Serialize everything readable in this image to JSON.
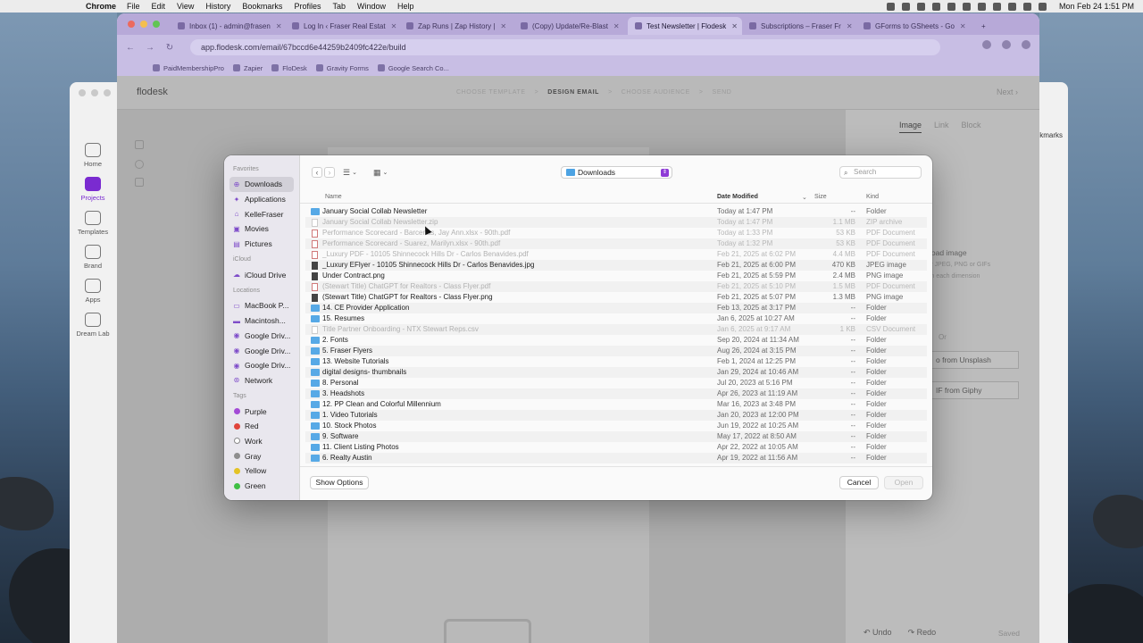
{
  "menubar": {
    "app": "Chrome",
    "items": [
      "File",
      "Edit",
      "View",
      "History",
      "Bookmarks",
      "Profiles",
      "Tab",
      "Window",
      "Help"
    ],
    "clock": "Mon Feb 24  1:51 PM"
  },
  "tabs": [
    {
      "label": "Inbox (1) - admin@frasen",
      "color": "#d9534f"
    },
    {
      "label": "Log In ‹ Fraser Real Estat",
      "color": "#5a5a5a"
    },
    {
      "label": "Zap Runs | Zap History |",
      "color": "#ff4f00"
    },
    {
      "label": "(Copy) Update/Re-Blast",
      "color": "#ff4f00"
    },
    {
      "label": "Test Newsletter | Flodesk",
      "color": "#333333"
    },
    {
      "label": "Subscriptions – Fraser Fr",
      "color": "#635bff"
    },
    {
      "label": "GForms to GSheets - Go",
      "color": "#1fa463"
    }
  ],
  "address": "app.flodesk.com/email/67bccd6e44259b2409fc422e/build",
  "bookmarks": [
    "PaidMembershipPro",
    "Zapier",
    "FloDesk",
    "Gravity Forms",
    "Google Search Co..."
  ],
  "flodesk": {
    "logo": "flodesk",
    "steps": [
      "CHOOSE TEMPLATE",
      ">",
      "DESIGN EMAIL",
      ">",
      "CHOOSE AUDIENCE",
      ">",
      "SEND"
    ],
    "next": "Next",
    "panel_tabs": [
      "Image",
      "Link",
      "Block"
    ],
    "upload_title": "load image",
    "upload_hint1": "y JPEG, PNG or GIFs",
    "upload_hint2": "in each dimension",
    "or": "Or",
    "unsplash": "o from Unsplash",
    "giphy": "IF from Giphy",
    "undo": "Undo",
    "redo": "Redo",
    "saved": "Saved"
  },
  "back_window": {
    "sidebar": [
      "Home",
      "Projects",
      "Templates",
      "Brand",
      "Apps",
      "Dream Lab"
    ],
    "bookmarks_label": "ckmarks"
  },
  "dialog": {
    "location": "Downloads",
    "search_placeholder": "Search",
    "sections": {
      "favorites": "Favorites",
      "icloud": "iCloud",
      "locations": "Locations",
      "tags": "Tags"
    },
    "favorites": [
      "Downloads",
      "Applications",
      "KelleFraser",
      "Movies",
      "Pictures"
    ],
    "icloud": [
      "iCloud Drive"
    ],
    "locations": [
      "MacBook P...",
      "Macintosh...",
      "Google Driv...",
      "Google Driv...",
      "Google Driv...",
      "Network"
    ],
    "tags": [
      {
        "name": "Purple",
        "color": "#a34bd6"
      },
      {
        "name": "Red",
        "color": "#e0443b"
      },
      {
        "name": "Work",
        "color": "#ffffff"
      },
      {
        "name": "Gray",
        "color": "#8e8e8e"
      },
      {
        "name": "Yellow",
        "color": "#e4c325"
      },
      {
        "name": "Green",
        "color": "#3fbf44"
      }
    ],
    "columns": {
      "name": "Name",
      "date": "Date Modified",
      "size": "Size",
      "kind": "Kind"
    },
    "files": [
      {
        "name": "January Social Collab Newsletter",
        "date": "Today at 1:47 PM",
        "size": "--",
        "kind": "Folder",
        "icon": "folder",
        "dim": false
      },
      {
        "name": "January Social Collab Newsletter.zip",
        "date": "Today at 1:47 PM",
        "size": "1.1 MB",
        "kind": "ZIP archive",
        "icon": "zip",
        "dim": true
      },
      {
        "name": "Performance Scorecard - Barcenas, Jay Ann.xlsx - 90th.pdf",
        "date": "Today at 1:33 PM",
        "size": "53 KB",
        "kind": "PDF Document",
        "icon": "doc",
        "dim": true
      },
      {
        "name": "Performance Scorecard - Suarez, Marilyn.xlsx - 90th.pdf",
        "date": "Today at 1:32 PM",
        "size": "53 KB",
        "kind": "PDF Document",
        "icon": "doc",
        "dim": true
      },
      {
        "name": "_Luxury PDF  - 10105 Shinnecock Hills Dr - Carlos Benavides.pdf",
        "date": "Feb 21, 2025 at 6:02 PM",
        "size": "4.4 MB",
        "kind": "PDF Document",
        "icon": "doc",
        "dim": true
      },
      {
        "name": "_Luxury EFlyer  - 10105 Shinnecock Hills Dr - Carlos Benavides.jpg",
        "date": "Feb 21, 2025 at 6:00 PM",
        "size": "470 KB",
        "kind": "JPEG image",
        "icon": "img",
        "dim": false
      },
      {
        "name": "Under Contract.png",
        "date": "Feb 21, 2025 at 5:59 PM",
        "size": "2.4 MB",
        "kind": "PNG image",
        "icon": "img",
        "dim": false
      },
      {
        "name": "(Stewart Title) ChatGPT for Realtors - Class Flyer.pdf",
        "date": "Feb 21, 2025 at 5:10 PM",
        "size": "1.5 MB",
        "kind": "PDF Document",
        "icon": "doc",
        "dim": true
      },
      {
        "name": "(Stewart Title) ChatGPT for Realtors - Class Flyer.png",
        "date": "Feb 21, 2025 at 5:07 PM",
        "size": "1.3 MB",
        "kind": "PNG image",
        "icon": "img",
        "dim": false
      },
      {
        "name": "14. CE Provider Application",
        "date": "Feb 13, 2025 at 3:17 PM",
        "size": "--",
        "kind": "Folder",
        "icon": "folder",
        "dim": false
      },
      {
        "name": "15. Resumes",
        "date": "Jan 6, 2025 at 10:27 AM",
        "size": "--",
        "kind": "Folder",
        "icon": "folder",
        "dim": false
      },
      {
        "name": "Title Partner Onboarding - NTX Stewart Reps.csv",
        "date": "Jan 6, 2025 at 9:17 AM",
        "size": "1 KB",
        "kind": "CSV Document",
        "icon": "csv",
        "dim": true
      },
      {
        "name": "2. Fonts",
        "date": "Sep 20, 2024 at 11:34 AM",
        "size": "--",
        "kind": "Folder",
        "icon": "folder",
        "dim": false
      },
      {
        "name": "5. Fraser Flyers",
        "date": "Aug 26, 2024 at 3:15 PM",
        "size": "--",
        "kind": "Folder",
        "icon": "folder",
        "dim": false
      },
      {
        "name": "13. Website Tutorials",
        "date": "Feb 1, 2024 at 12:25 PM",
        "size": "--",
        "kind": "Folder",
        "icon": "folder",
        "dim": false
      },
      {
        "name": "digital designs- thumbnails",
        "date": "Jan 29, 2024 at 10:46 AM",
        "size": "--",
        "kind": "Folder",
        "icon": "folder",
        "dim": false
      },
      {
        "name": "8. Personal",
        "date": "Jul 20, 2023 at 5:16 PM",
        "size": "--",
        "kind": "Folder",
        "icon": "folder",
        "dim": false
      },
      {
        "name": "3. Headshots",
        "date": "Apr 26, 2023 at 11:19 AM",
        "size": "--",
        "kind": "Folder",
        "icon": "folder",
        "dim": false
      },
      {
        "name": "12. PP Clean and Colorful Millennium",
        "date": "Mar 16, 2023 at 3:48 PM",
        "size": "--",
        "kind": "Folder",
        "icon": "folder",
        "dim": false
      },
      {
        "name": "1. Video Tutorials",
        "date": "Jan 20, 2023 at 12:00 PM",
        "size": "--",
        "kind": "Folder",
        "icon": "folder",
        "dim": false
      },
      {
        "name": "10. Stock Photos",
        "date": "Jun 19, 2022 at 10:25 AM",
        "size": "--",
        "kind": "Folder",
        "icon": "folder",
        "dim": false
      },
      {
        "name": "9. Software",
        "date": "May 17, 2022 at 8:50 AM",
        "size": "--",
        "kind": "Folder",
        "icon": "folder",
        "dim": false
      },
      {
        "name": "11. Client Listing Photos",
        "date": "Apr 22, 2022 at 10:05 AM",
        "size": "--",
        "kind": "Folder",
        "icon": "folder",
        "dim": false
      },
      {
        "name": "6. Realty Austin",
        "date": "Apr 19, 2022 at 11:56 AM",
        "size": "--",
        "kind": "Folder",
        "icon": "folder",
        "dim": false
      }
    ],
    "show_options": "Show Options",
    "cancel": "Cancel",
    "open": "Open"
  }
}
